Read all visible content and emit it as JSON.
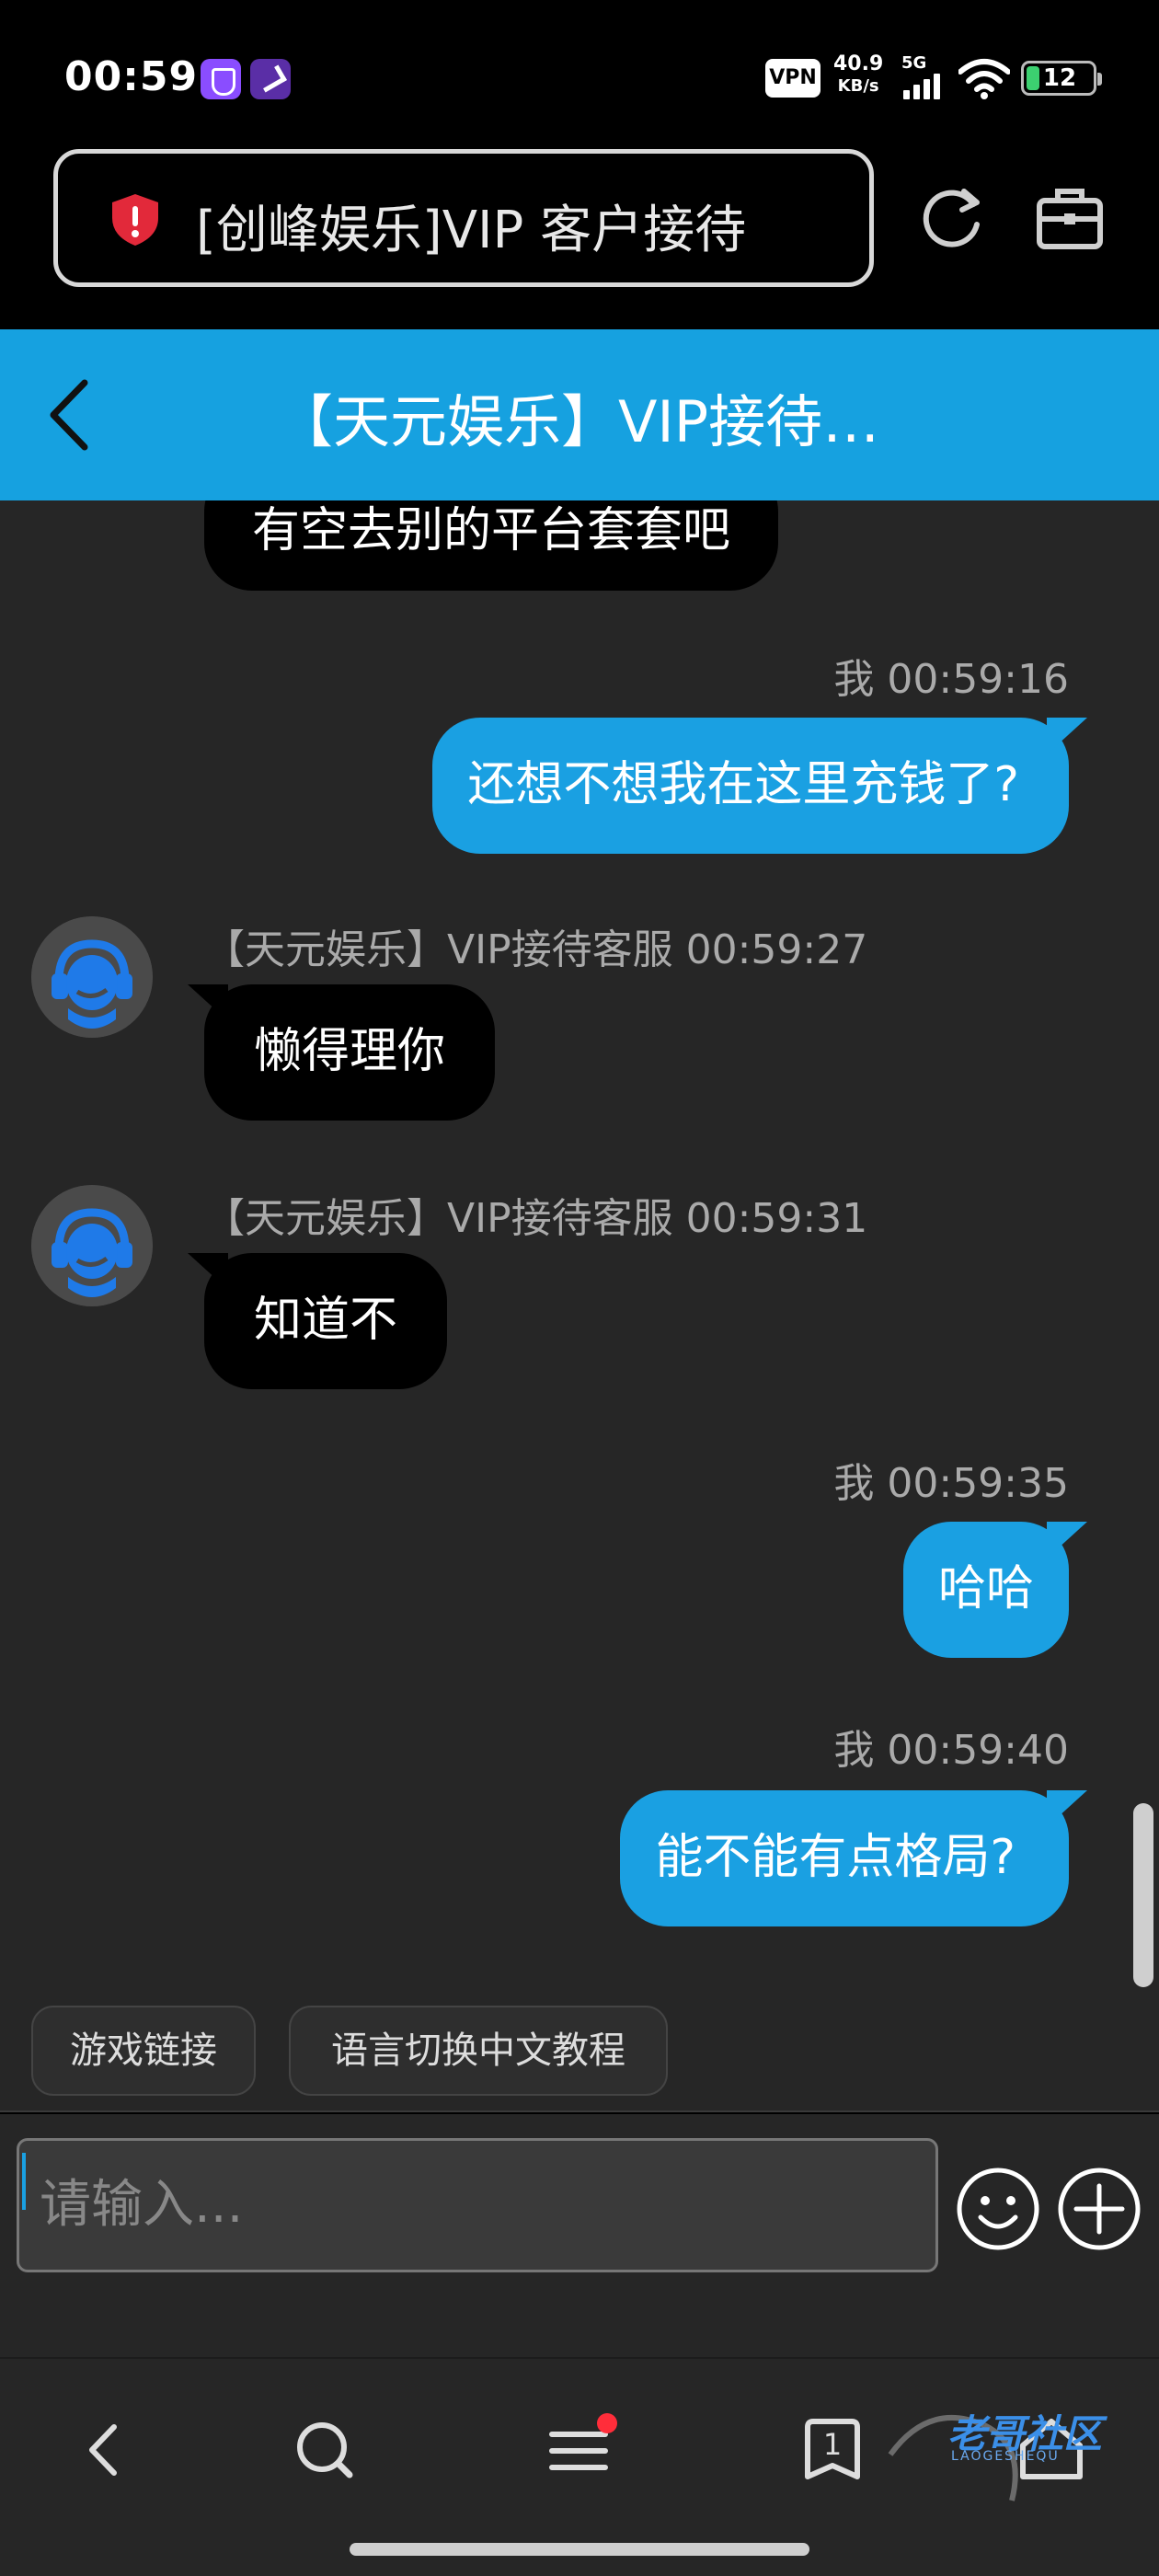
{
  "status_bar": {
    "time": "00:59",
    "vpn": "VPN",
    "net_speed_value": "40.9",
    "net_speed_unit": "KB/s",
    "signal_label": "5G",
    "battery": "12"
  },
  "url_bar": {
    "text": "[创峰娱乐]VIP 客户接待"
  },
  "header": {
    "title": "【天元娱乐】VIP接待…"
  },
  "messages": [
    {
      "side": "in",
      "text": "有空去别的平台套套吧"
    },
    {
      "side": "out",
      "sender": "我",
      "time": "00:59:16",
      "meta": "我 00:59:16",
      "text": "还想不想我在这里充钱了?"
    },
    {
      "side": "in",
      "sender": "【天元娱乐】VIP接待客服",
      "time": "00:59:27",
      "meta": "【天元娱乐】VIP接待客服 00:59:27",
      "text": "懒得理你"
    },
    {
      "side": "in",
      "sender": "【天元娱乐】VIP接待客服",
      "time": "00:59:31",
      "meta": "【天元娱乐】VIP接待客服 00:59:31",
      "text": "知道不"
    },
    {
      "side": "out",
      "sender": "我",
      "time": "00:59:35",
      "meta": "我 00:59:35",
      "text": "哈哈"
    },
    {
      "side": "out",
      "sender": "我",
      "time": "00:59:40",
      "meta": "我 00:59:40",
      "text": "能不能有点格局?"
    }
  ],
  "quick_replies": [
    "游戏链接",
    "语言切换中文教程"
  ],
  "input": {
    "placeholder": "请输入..."
  },
  "bottom_nav": {
    "tab_count": "1"
  },
  "watermark": {
    "text": "老哥社区",
    "sub": "LAOGESHEQU"
  },
  "colors": {
    "header_bg": "#16a1e0",
    "outgoing_bubble": "#1aa0e2",
    "incoming_bubble": "#000000",
    "chat_bg": "#262626",
    "notification_dot": "#ff2d3a"
  }
}
